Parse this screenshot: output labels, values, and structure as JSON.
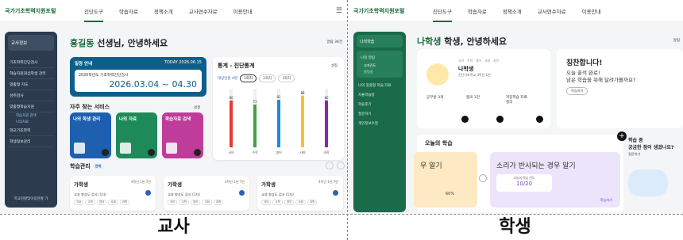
{
  "teacher": {
    "logo": "국가기초학력지원포털",
    "nav": [
      "진단도구",
      "학습자료",
      "정책소개",
      "교사연수자료",
      "이용안내"
    ],
    "sidebar": {
      "school": "교사정보",
      "items": [
        "기초학력진단검사",
        "학습지원대상학생 관리",
        "맞춤형 지도",
        "성취검사",
        "맞춤형학습지원",
        "학교기초학력",
        "학생정보관리"
      ],
      "subs": [
        "학습지원 검색",
        "나의자료"
      ],
      "footer": "학교현황및이용현황 가"
    },
    "greeting_name": "홍길동",
    "greeting_rest": " 선생님, 안녕하세요",
    "setting": "알림 34건",
    "exam": {
      "title": "일정 안내",
      "today": "TODAY  2026.06.15",
      "label": "2026학년도 기초학력진단검사",
      "range": "2026.03.04 ~ 04.30"
    },
    "services_title": "자주 찾는 서비스",
    "services_edit": "설정",
    "services": [
      "나의 학생 관리",
      "나의 자료",
      "학습자료 검색"
    ],
    "stat": {
      "title": "통계 - 진단통계",
      "edit": "설정",
      "tab_label": "대상인원 4명",
      "pills": [
        "1회차",
        "2회차",
        "3회차"
      ]
    },
    "chart_data": {
      "type": "bar",
      "categories": [
        "국어",
        "수학",
        "영어",
        "사회",
        "과학"
      ],
      "values": [
        80,
        73,
        81,
        88,
        80
      ],
      "ylim": [
        0,
        100
      ]
    },
    "study": {
      "title": "학습관리",
      "badge": "전체",
      "cards": [
        {
          "name": "가학생",
          "date": "4학년 1반 7번",
          "line": "교과 향상도 검사 (1차)",
          "chips": [
            "국어",
            "수학",
            "영어",
            "사회",
            "과학"
          ]
        },
        {
          "name": "가학생",
          "date": "4학년 1반 7번",
          "line": "교과 향상도 검사 (1차)",
          "chips": [
            "국어",
            "수학",
            "영어",
            "사회",
            "과학"
          ]
        },
        {
          "name": "가학생",
          "date": "4학년 1반 7번",
          "line": "교과 향상도 검사 (1차)",
          "chips": [
            "국어",
            "수학",
            "영어",
            "사회",
            "과학"
          ]
        }
      ]
    },
    "caption": "교사"
  },
  "student": {
    "logo": "국가기초학력지원포털",
    "nav": [
      "진단도구",
      "학습자료",
      "정책소개",
      "교사연수자료",
      "이용안내"
    ],
    "sidebar": {
      "school": "나의학습",
      "items": [
        "나의 맞춤형 학습 자료",
        "자율학습방",
        "학습후기",
        "질문하기",
        "개인정보수정"
      ],
      "boxtitle": "나의 알림",
      "subs": [
        "교과진도",
        "알림중"
      ]
    },
    "greeting_name": "나학생",
    "greeting_rest": " 학생, 안녕하세요",
    "setting": "알림",
    "profile": {
      "tags": [
        "국어",
        "수학",
        "영어",
        "사회",
        "과학"
      ],
      "name": "나학생",
      "sub": "진단기초학교 3학년 1반",
      "stats": [
        "공부방 3개",
        "찜의 3건",
        "저장학습 자료정리"
      ]
    },
    "praise": {
      "title": "칭찬합니다!",
      "msg1": "오늘 출석 완료!",
      "msg2": "남은 학습을 위해 달려가볼까요?",
      "btn": "학습하기"
    },
    "today": {
      "title": "오늘의 학습",
      "card1": "우 알기",
      "card2": "소리가 반사되는 경우 알기",
      "progress_label": "오늘의 학습 진도",
      "progress": "10/20",
      "pct": "60%",
      "btn": "학습하기"
    },
    "side": {
      "q1": "학습 중",
      "q2": "궁금한 점이 생겼나요?",
      "q3": "질문하기"
    },
    "caption": "학생"
  }
}
